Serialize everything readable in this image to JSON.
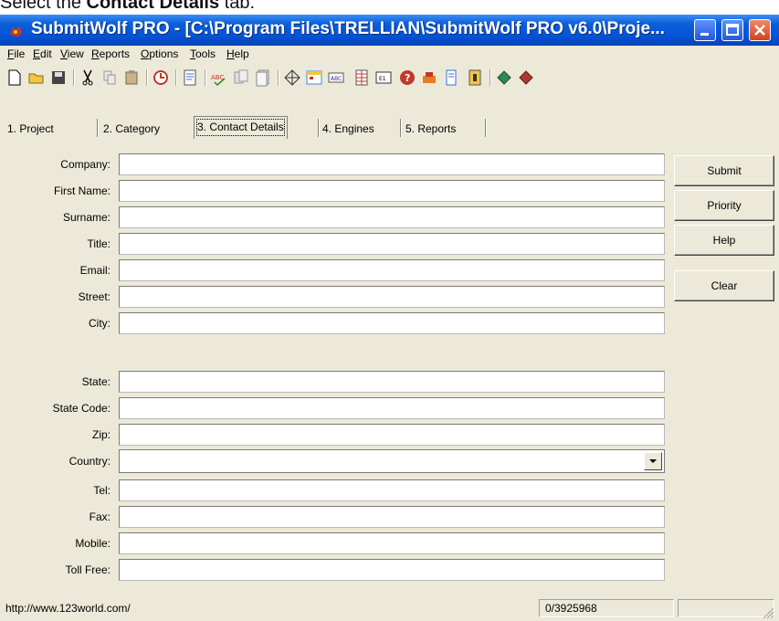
{
  "caption": {
    "prefix": "Select the ",
    "bold": "Contact Details",
    "suffix": " tab."
  },
  "window": {
    "title": "SubmitWolf PRO - [C:\\Program Files\\TRELLIAN\\SubmitWolf PRO v6.0\\Proje..."
  },
  "menu": [
    "File",
    "Edit",
    "View",
    "Reports",
    "Options",
    "Tools",
    "Help"
  ],
  "toolbar_icons": [
    "new-icon",
    "open-icon",
    "save-icon",
    "cut-icon",
    "copy-icon",
    "paste-icon",
    "clock-icon",
    "report-icon",
    "spellcheck-icon",
    "copy-doc-icon",
    "document-icon",
    "target-icon",
    "calendar-icon",
    "text-icon",
    "grid-icon",
    "window-icon",
    "help-icon",
    "tools-icon",
    "file-icon",
    "info-icon",
    "engine-green-icon",
    "engine-red-icon"
  ],
  "tabs": [
    "1. Project",
    "2. Category",
    "3. Contact Details",
    "4. Engines",
    "5. Reports"
  ],
  "active_tab": "3. Contact Details",
  "fields": {
    "company": {
      "label": "Company:",
      "value": ""
    },
    "first_name": {
      "label": "First Name:",
      "value": ""
    },
    "surname": {
      "label": "Surname:",
      "value": ""
    },
    "title": {
      "label": "Title:",
      "value": ""
    },
    "email": {
      "label": "Email:",
      "value": ""
    },
    "street": {
      "label": "Street:",
      "value": ""
    },
    "city": {
      "label": "City:",
      "value": ""
    },
    "state": {
      "label": "State:",
      "value": ""
    },
    "state_code": {
      "label": "State Code:",
      "value": ""
    },
    "zip": {
      "label": "Zip:",
      "value": ""
    },
    "country": {
      "label": "Country:",
      "value": ""
    },
    "tel": {
      "label": "Tel:",
      "value": ""
    },
    "fax": {
      "label": "Fax:",
      "value": ""
    },
    "mobile": {
      "label": "Mobile:",
      "value": ""
    },
    "toll_free": {
      "label": "Toll Free:",
      "value": ""
    }
  },
  "buttons": {
    "submit": "Submit",
    "priority": "Priority",
    "help": "Help",
    "clear": "Clear"
  },
  "status": {
    "url": "http://www.123world.com/",
    "counter": "0/3925968",
    "extra": ""
  },
  "colors": {
    "titlebar": "#0553d6",
    "window_bg": "#ece9d8",
    "close_button": "#d2411c"
  }
}
